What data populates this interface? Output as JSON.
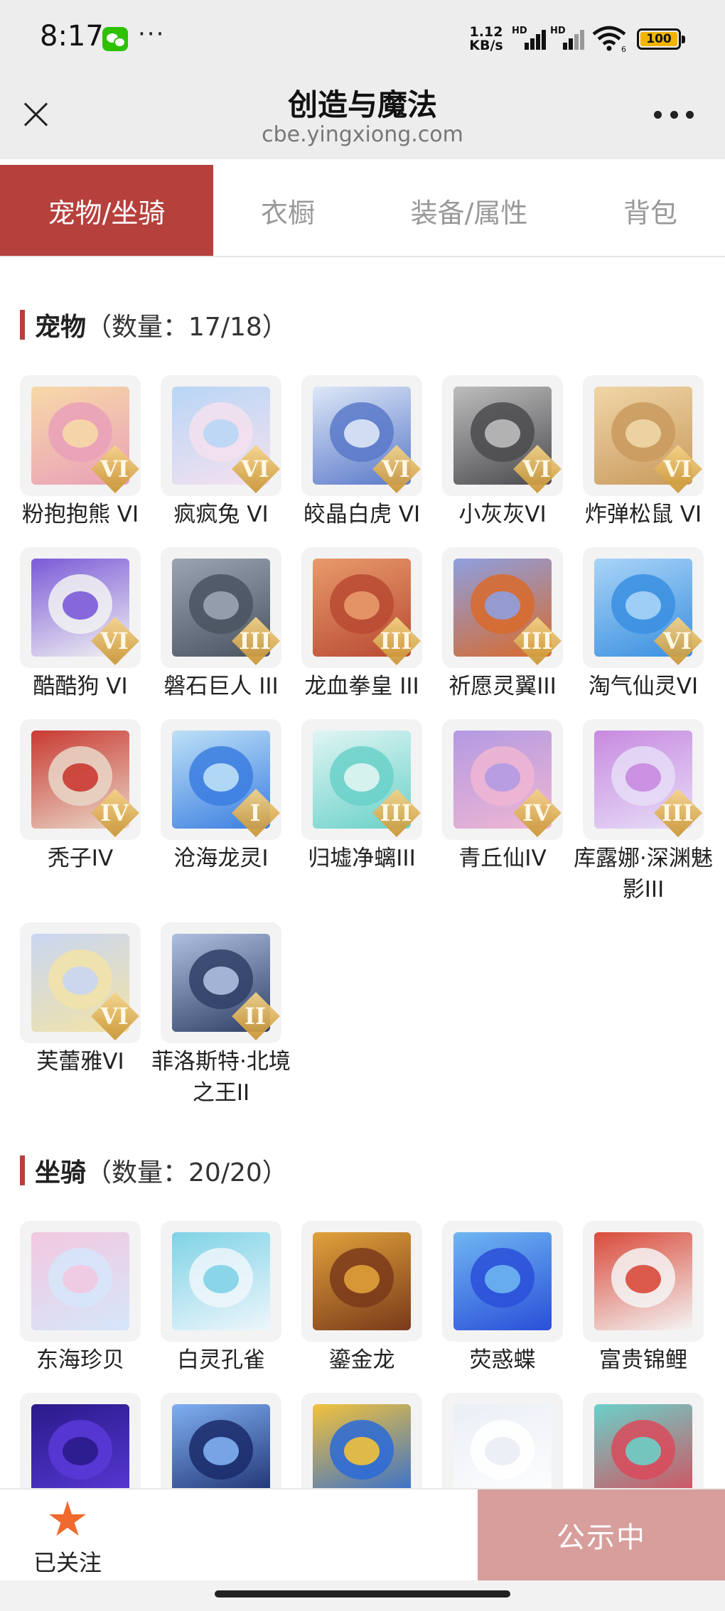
{
  "status_bar": {
    "time": "8:17",
    "dots": "···",
    "net_speed_value": "1.12",
    "net_speed_unit": "KB/s",
    "signal1_label": "HD",
    "signal2_label": "HD",
    "wifi_badge": "6",
    "battery": "100"
  },
  "header": {
    "title": "创造与魔法",
    "subtitle": "cbe.yingxiong.com"
  },
  "tabs": [
    {
      "label": "宠物/坐骑",
      "active": true
    },
    {
      "label": "衣橱",
      "active": false
    },
    {
      "label": "装备/属性",
      "active": false
    },
    {
      "label": "背包",
      "active": false
    }
  ],
  "pets": {
    "title": "宠物",
    "count": "（数量：17/18）",
    "items": [
      {
        "name": "粉抱抱熊 VI",
        "grade": "VI",
        "colors": [
          "#e9a0b8",
          "#f7d9a8"
        ]
      },
      {
        "name": "疯疯兔 VI",
        "grade": "VI",
        "colors": [
          "#f5e1ef",
          "#b8d6f5"
        ]
      },
      {
        "name": "皎晶白虎 VI",
        "grade": "VI",
        "colors": [
          "#5a79c9",
          "#dde7f7"
        ]
      },
      {
        "name": "小灰灰VI",
        "grade": "VI",
        "colors": [
          "#4b4b4f",
          "#bdbdbd"
        ]
      },
      {
        "name": "炸弹松鼠 VI",
        "grade": "VI",
        "colors": [
          "#c99a5e",
          "#f0d6a7"
        ]
      },
      {
        "name": "酷酷狗 VI",
        "grade": "VI",
        "colors": [
          "#f2f2f2",
          "#7b5ad8"
        ]
      },
      {
        "name": "磐石巨人 III",
        "grade": "III",
        "colors": [
          "#4a5360",
          "#9aa4b2"
        ]
      },
      {
        "name": "龙血拳皇 III",
        "grade": "III",
        "colors": [
          "#b84a33",
          "#e89a6b"
        ]
      },
      {
        "name": "祈愿灵翼III",
        "grade": "III",
        "colors": [
          "#d86a2c",
          "#8e9fe0"
        ]
      },
      {
        "name": "淘气仙灵VI",
        "grade": "VI",
        "colors": [
          "#3a8fe0",
          "#a9d4f7"
        ]
      },
      {
        "name": "秃子IV",
        "grade": "IV",
        "colors": [
          "#e9d7c8",
          "#c93a32"
        ]
      },
      {
        "name": "沧海龙灵I",
        "grade": "I",
        "colors": [
          "#3b7ee0",
          "#bde0f7"
        ]
      },
      {
        "name": "归墟净螭III",
        "grade": "III",
        "colors": [
          "#6ad1c9",
          "#e0f5f3"
        ]
      },
      {
        "name": "青丘仙IV",
        "grade": "IV",
        "colors": [
          "#f0b6d2",
          "#b39ae3"
        ]
      },
      {
        "name": "库露娜·深渊魅影III",
        "grade": "III",
        "colors": [
          "#e6ddf7",
          "#c88ae0"
        ]
      },
      {
        "name": "芙蕾雅VI",
        "grade": "VI",
        "colors": [
          "#f2e3a8",
          "#c9d6f2"
        ]
      },
      {
        "name": "菲洛斯特·北境之王II",
        "grade": "II",
        "colors": [
          "#2f3f66",
          "#aebfe0"
        ]
      }
    ]
  },
  "mounts": {
    "title": "坐骑",
    "count": "（数量：20/20）",
    "items": [
      {
        "name": "东海珍贝",
        "colors": [
          "#d6e6fa",
          "#f2c8e0"
        ]
      },
      {
        "name": "白灵孔雀",
        "colors": [
          "#eef6fb",
          "#7fd3e6"
        ]
      },
      {
        "name": "鎏金龙",
        "colors": [
          "#7a3a1a",
          "#e0a13b"
        ]
      },
      {
        "name": "荧惑蝶",
        "colors": [
          "#2a4fd8",
          "#6fb6f2"
        ]
      },
      {
        "name": "富贵锦鲤",
        "colors": [
          "#f4f4f4",
          "#d94a3a"
        ]
      },
      {
        "name": "",
        "colors": [
          "#5a3ad8",
          "#2a1a8a"
        ]
      },
      {
        "name": "",
        "colors": [
          "#1a2a6a",
          "#7fb0f2"
        ]
      },
      {
        "name": "",
        "colors": [
          "#2a6ad8",
          "#f2c23b"
        ]
      },
      {
        "name": "",
        "colors": [
          "#ffffff",
          "#eaeef5"
        ]
      },
      {
        "name": "",
        "colors": [
          "#d94a5a",
          "#6ad1c9"
        ]
      }
    ]
  },
  "bottom": {
    "follow_label": "已关注",
    "publicity_label": "公示中"
  }
}
